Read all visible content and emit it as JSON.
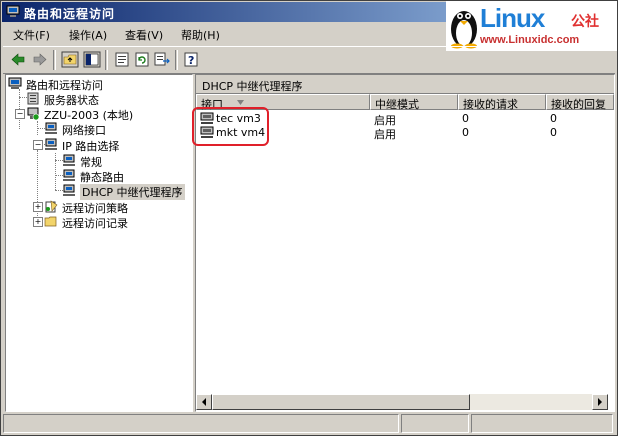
{
  "window": {
    "title": "路由和远程访问"
  },
  "logo": {
    "brand": "Linux",
    "brand_cn": "公社",
    "url": "www.Linuxidc.com"
  },
  "menu": {
    "items": [
      "文件(F)",
      "操作(A)",
      "查看(V)",
      "帮助(H)"
    ]
  },
  "tree": {
    "root": "路由和远程访问",
    "server_status": "服务器状态",
    "server": "ZZU-2003 (本地)",
    "network_interfaces": "网络接口",
    "ip_routing": "IP 路由选择",
    "general": "常规",
    "static_routes": "静态路由",
    "dhcp_relay": "DHCP 中继代理程序",
    "remote_access_policy": "远程访问策略",
    "remote_access_logging": "远程访问记录"
  },
  "pane": {
    "header": "DHCP 中继代理程序",
    "columns": [
      "接口",
      "中继模式",
      "接收的请求",
      "接收的回复"
    ],
    "rows": [
      {
        "name": "tec vm3",
        "mode": "启用",
        "requests": "0",
        "replies": "0"
      },
      {
        "name": "mkt vm4",
        "mode": "启用",
        "requests": "0",
        "replies": "0"
      }
    ]
  },
  "colors": {
    "title_start": "#0a246a",
    "title_end": "#a6caf0",
    "highlight_box": "#e0202a"
  }
}
